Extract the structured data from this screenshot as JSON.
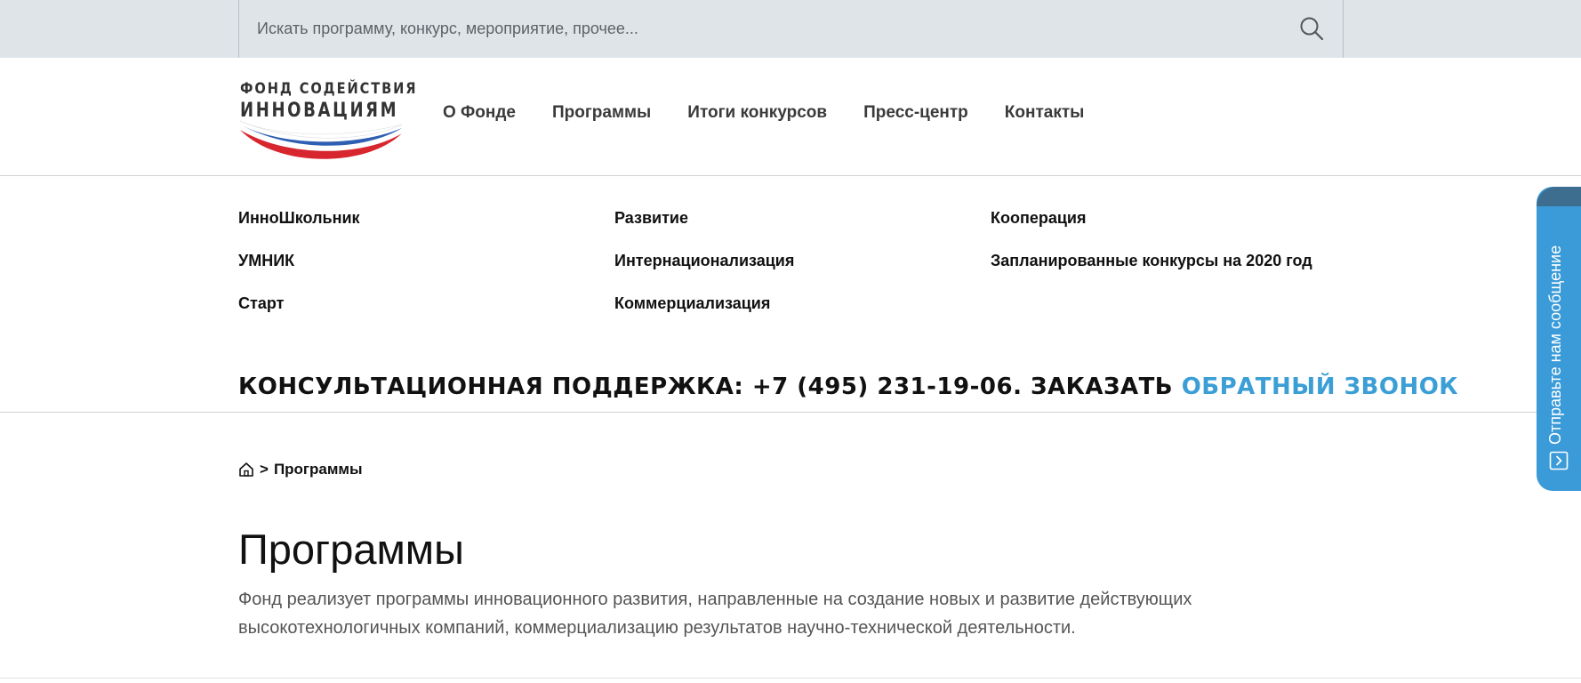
{
  "search": {
    "placeholder": "Искать программу, конкурс, мероприятие, прочее..."
  },
  "logo": {
    "line1": "ФОНД СОДЕЙСТВИЯ",
    "line2": "ИННОВАЦИЯМ"
  },
  "nav": [
    "О Фонде",
    "Программы",
    "Итоги конкурсов",
    "Пресс-центр",
    "Контакты"
  ],
  "programs_menu": {
    "col1": [
      "ИнноШкольник",
      "УМНИК",
      "Старт"
    ],
    "col2": [
      "Развитие",
      "Интернационализация",
      "Коммерциализация"
    ],
    "col3": [
      "Кооперация",
      "Запланированные конкурсы на 2020 год"
    ]
  },
  "support": {
    "text": "КОНСУЛЬТАЦИОННАЯ ПОДДЕРЖКА: +7 (495) 231-19-06. ЗАКАЗАТЬ",
    "link": "ОБРАТНЫЙ ЗВОНОК"
  },
  "breadcrumb": {
    "separator": ">",
    "current": "Программы"
  },
  "page": {
    "title": "Программы",
    "intro": "Фонд реализует программы инновационного развития, направленные на создание новых и развитие действующих высокотехнологичных компаний, коммерциализацию результатов научно-технической деятельности."
  },
  "feedback": {
    "label": "Отправьте нам сообщение"
  },
  "colors": {
    "accent": "#3b9fd6",
    "topbar": "#dfe4e8",
    "feedback": "#3a9bd8"
  },
  "icons": [
    "search-icon",
    "home-icon",
    "chevron-right-icon"
  ]
}
